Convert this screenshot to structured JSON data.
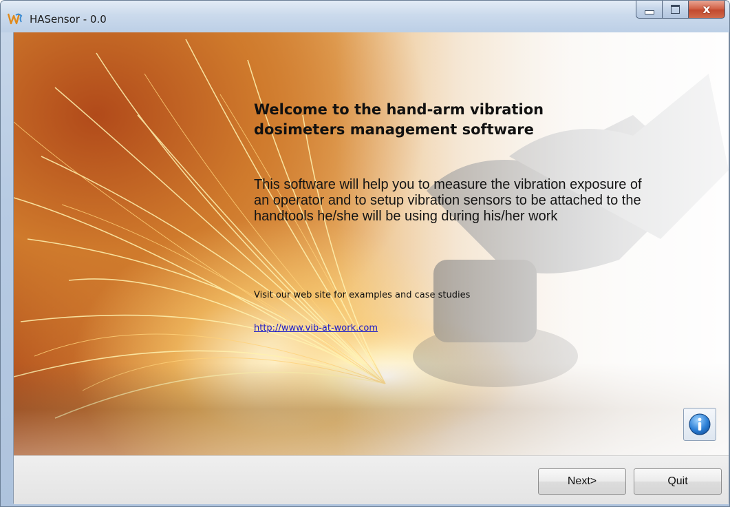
{
  "window": {
    "title": "HASensor - 0.0",
    "controls": {
      "minimize": "minimize",
      "maximize": "maximize",
      "close": "x"
    }
  },
  "main": {
    "welcome_title_line1": "Welcome to the hand-arm vibration",
    "welcome_title_line2": "dosimeters management software",
    "intro_text": "This software will help you to measure the vibration exposure of an operator and to setup vibration sensors to be attached to the handtools he/she will be using during his/her work",
    "visit_text": "Visit our web site for examples and case studies",
    "link_text": "http://www.vib-at-work.com",
    "info_icon": "info-icon"
  },
  "footer": {
    "next_label": "Next>",
    "quit_label": "Quit"
  },
  "colors": {
    "link": "#1a1ac8",
    "hero_warm": "#d88838",
    "title_bar": "#cbdaec"
  }
}
